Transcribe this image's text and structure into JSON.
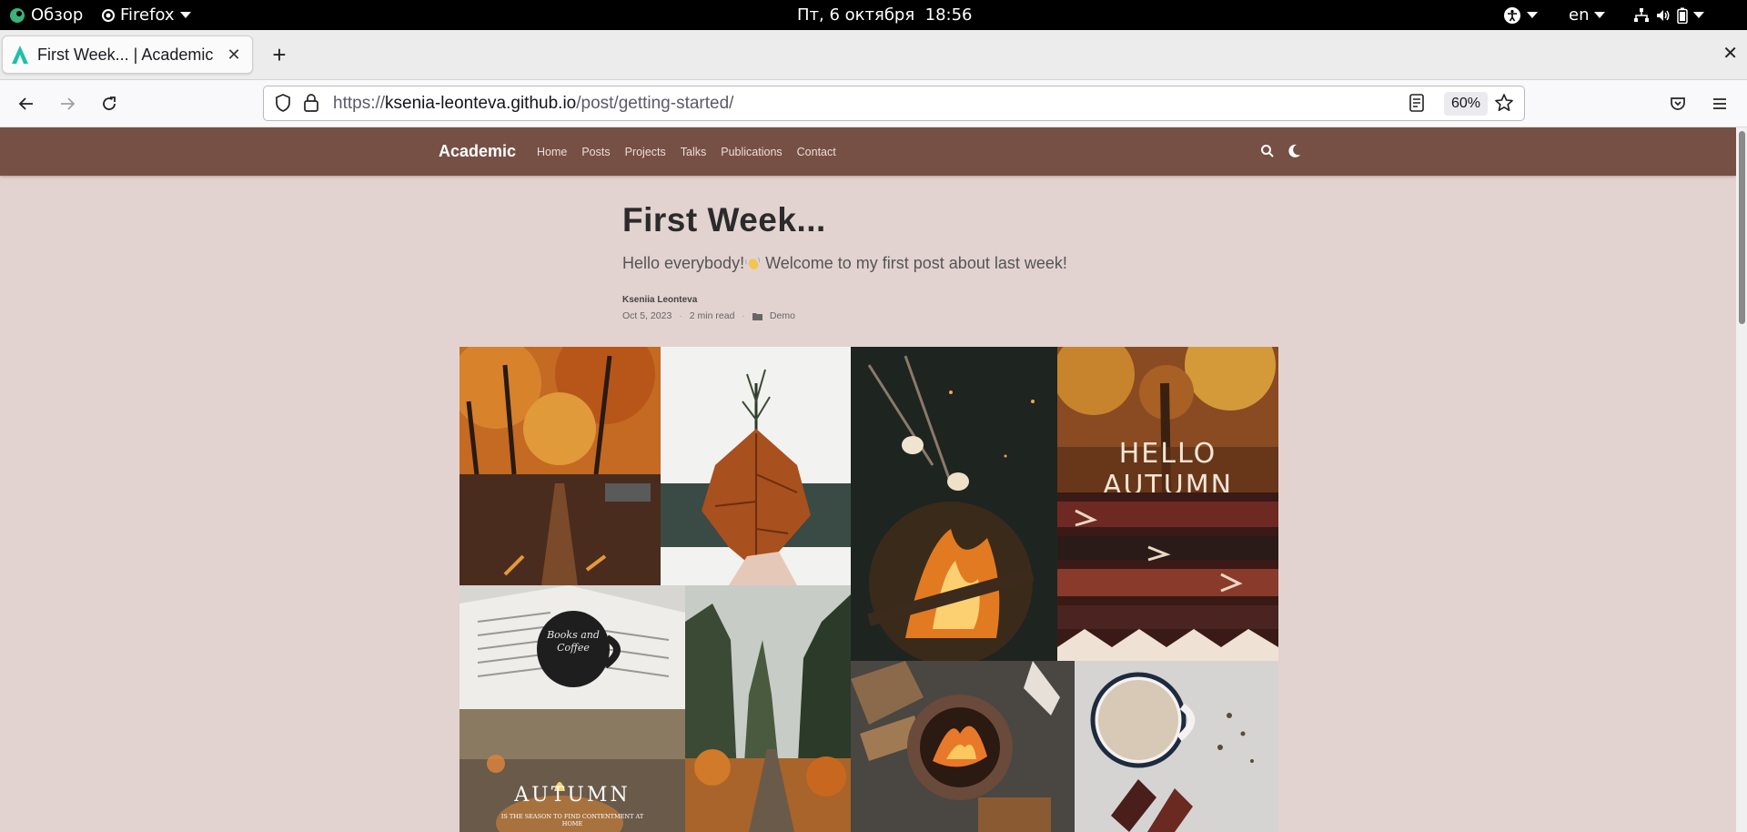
{
  "system_bar": {
    "overview_label": "Обзор",
    "app_label": "Firefox",
    "clock": "Пт, 6 октября  18:56",
    "language": "en"
  },
  "browser": {
    "tab_title": "First Week... | Academic",
    "url_scheme": "https://",
    "url_host": "ksenia-leonteva.github.io",
    "url_path": "/post/getting-started/",
    "zoom": "60%"
  },
  "site": {
    "brand": "Academic",
    "nav": [
      "Home",
      "Posts",
      "Projects",
      "Talks",
      "Publications",
      "Contact"
    ]
  },
  "article": {
    "title": "First Week...",
    "subtitle_before": "Hello everybody!",
    "subtitle_after": " Welcome to my first post about last week!",
    "author": "Kseniia Leonteva",
    "date": "Oct 5, 2023",
    "read_time": "2 min read",
    "category": "Demo"
  },
  "collage": {
    "hello_autumn": "HELLO AUTUMN",
    "mug_text": "Books and Coffee",
    "autumn_word": "AUTUMN",
    "autumn_small": "IS THE SEASON TO FIND CONTENTMENT AT HOME"
  },
  "colors": {
    "site_nav": "#765045",
    "page_bg": "#e2d3d0"
  }
}
